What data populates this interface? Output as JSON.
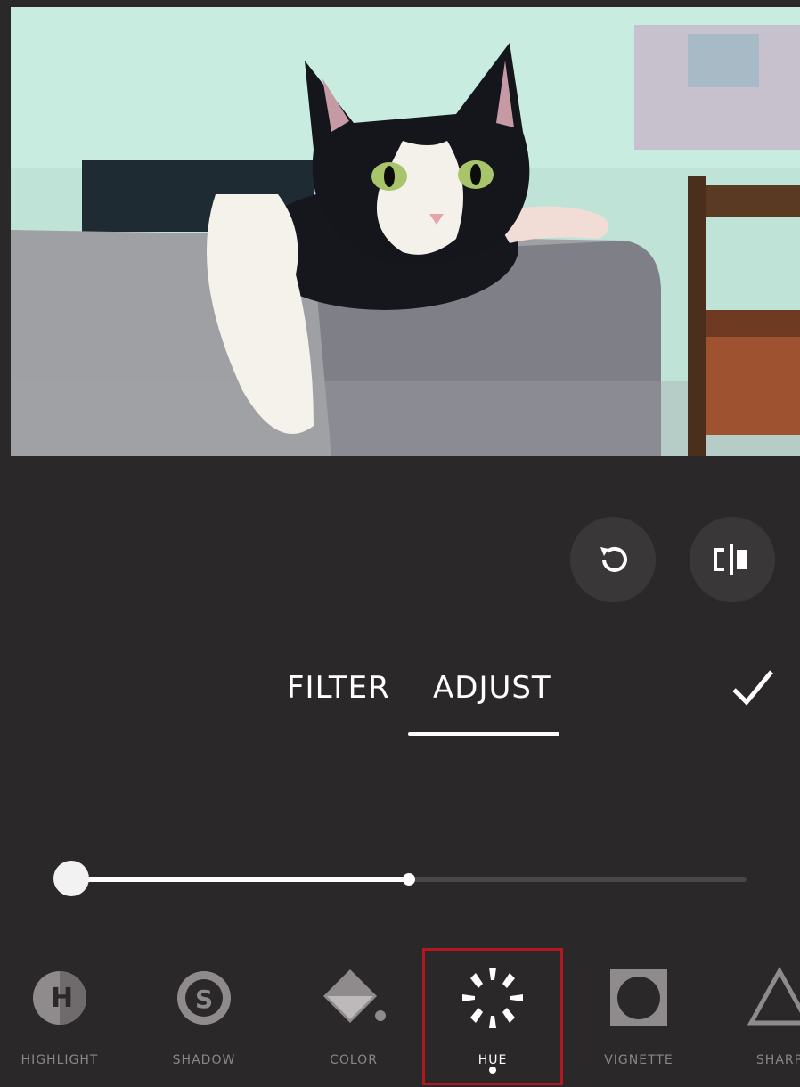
{
  "photo": {
    "description_icon": "photo-preview"
  },
  "actions": {
    "rotate": {
      "icon": "rotate-icon"
    },
    "compare": {
      "icon": "compare-icon"
    }
  },
  "tabs": [
    {
      "label": "FILTER",
      "active": false
    },
    {
      "label": "ADJUST",
      "active": true
    }
  ],
  "confirm_icon": "check-icon",
  "slider": {
    "value": 0.0,
    "midpoint": 0.5,
    "fill_to": 0.5
  },
  "tools": [
    {
      "label": "HIGHLIGHT",
      "icon": "highlight-icon"
    },
    {
      "label": "SHADOW",
      "icon": "shadow-icon"
    },
    {
      "label": "COLOR",
      "icon": "color-icon"
    },
    {
      "label": "HUE",
      "icon": "hue-icon",
      "selected": true
    },
    {
      "label": "VIGNETTE",
      "icon": "vignette-icon"
    },
    {
      "label": "SHARP",
      "icon": "sharpen-icon"
    }
  ],
  "colors": {
    "background": "#2b2829",
    "selected_border": "#b3171f",
    "button": "#3a3738"
  }
}
